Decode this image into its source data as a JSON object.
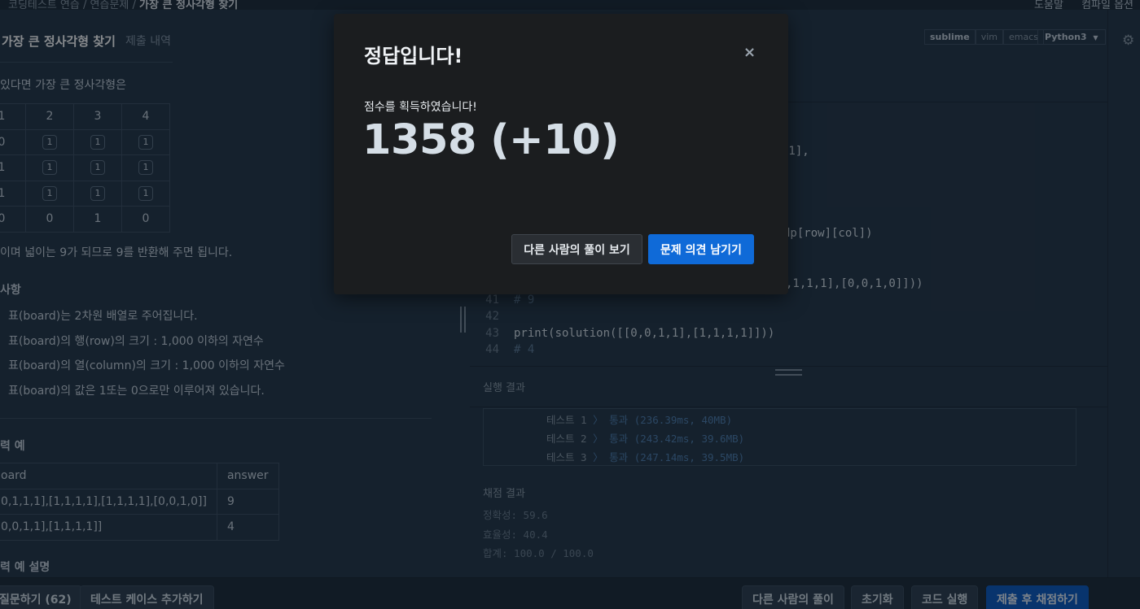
{
  "breadcrumb": {
    "items": [
      "코딩테스트 연습",
      "연습문제",
      "가장 큰 정사각형 찾기"
    ],
    "separator": "/"
  },
  "header_right": {
    "help": "도움말",
    "dark_mode": "컴파일 옵션"
  },
  "problem": {
    "title": "가장 큰 정사각형 찾기",
    "submissions_tab": "제출 내역",
    "intro_text": "있다면 가장 큰 정사각형은",
    "grid": [
      [
        "1",
        "2",
        "3",
        "4"
      ],
      [
        "0",
        "1",
        "1",
        "1"
      ],
      [
        "1",
        "1",
        "1",
        "1"
      ],
      [
        "1",
        "1",
        "1",
        "1"
      ],
      [
        "0",
        "0",
        "1",
        "0"
      ]
    ],
    "area_text": "이며 넓이는 9가 되므로 9를 반환해 주면 됩니다.",
    "constraints_title": "사항",
    "constraints": [
      "표(board)는 2차원 배열로 주어집니다.",
      "표(board)의 행(row)의 크기 : 1,000 이하의 자연수",
      "표(board)의 열(column)의 크기 : 1,000 이하의 자연수",
      "표(board)의 값은 1또는 0으로만 이루어져 있습니다."
    ],
    "examples_title": "력 예",
    "examples_header": [
      "oard",
      "answer"
    ],
    "examples": [
      [
        "0,1,1,1],[1,1,1,1],[1,1,1,1],[0,0,1,0]]",
        "9"
      ],
      [
        "0,0,1,1],[1,1,1,1]]",
        "4"
      ]
    ],
    "explanation_title": "력 예 설명"
  },
  "editor": {
    "keymaps": [
      "sublime",
      "vim",
      "emacs"
    ],
    "language": "Python3",
    "visible_fragments": [
      ",",
      "-1],",
      "dp[row][col])",
      ",1,1,1],[0,0,1,0]]))"
    ],
    "lines": [
      {
        "no": "41",
        "code": "# 9",
        "kind": "comment"
      },
      {
        "no": "42",
        "code": "",
        "kind": "blank"
      },
      {
        "no": "43",
        "code": "print(solution([[0,0,1,1],[1,1,1,1]]))",
        "kind": "code"
      },
      {
        "no": "44",
        "code": "# 4",
        "kind": "comment"
      }
    ]
  },
  "run_result": {
    "label": "실행 결과",
    "tests": [
      {
        "name": "테스트 1",
        "sep": "〉",
        "status": "통과",
        "detail": "(236.39ms, 40MB)"
      },
      {
        "name": "테스트 2",
        "sep": "〉",
        "status": "통과",
        "detail": "(243.42ms, 39.6MB)"
      },
      {
        "name": "테스트 3",
        "sep": "〉",
        "status": "통과",
        "detail": "(247.14ms, 39.5MB)"
      }
    ]
  },
  "grading": {
    "label": "채점 결과",
    "accuracy": "정확성: 59.6",
    "efficiency": "효율성: 40.4",
    "total": "합계: 100.0 / 100.0"
  },
  "footer": {
    "question_button": "질문하기 (62)",
    "add_testcase_button": "테스트 케이스 추가하기",
    "others_solutions_button": "다른 사람의 풀이",
    "reset_button": "초기화",
    "run_button": "코드 실행",
    "submit_button": "제출 후 채점하기"
  },
  "modal": {
    "title": "정답입니다!",
    "close_glyph": "×",
    "message": "점수를 획득하였습니다!",
    "score": "1358 (+10)",
    "view_others_button": "다른 사람의 풀이 보기",
    "leave_feedback_button": "문제 의견 남기기"
  },
  "colors": {
    "background": "#263747",
    "modal_background": "#1b1d1f",
    "primary_button": "#0f6ad8",
    "pass_text": "#4f7fb1"
  },
  "icons": {
    "settings": "gear-icon",
    "close": "close-icon"
  }
}
